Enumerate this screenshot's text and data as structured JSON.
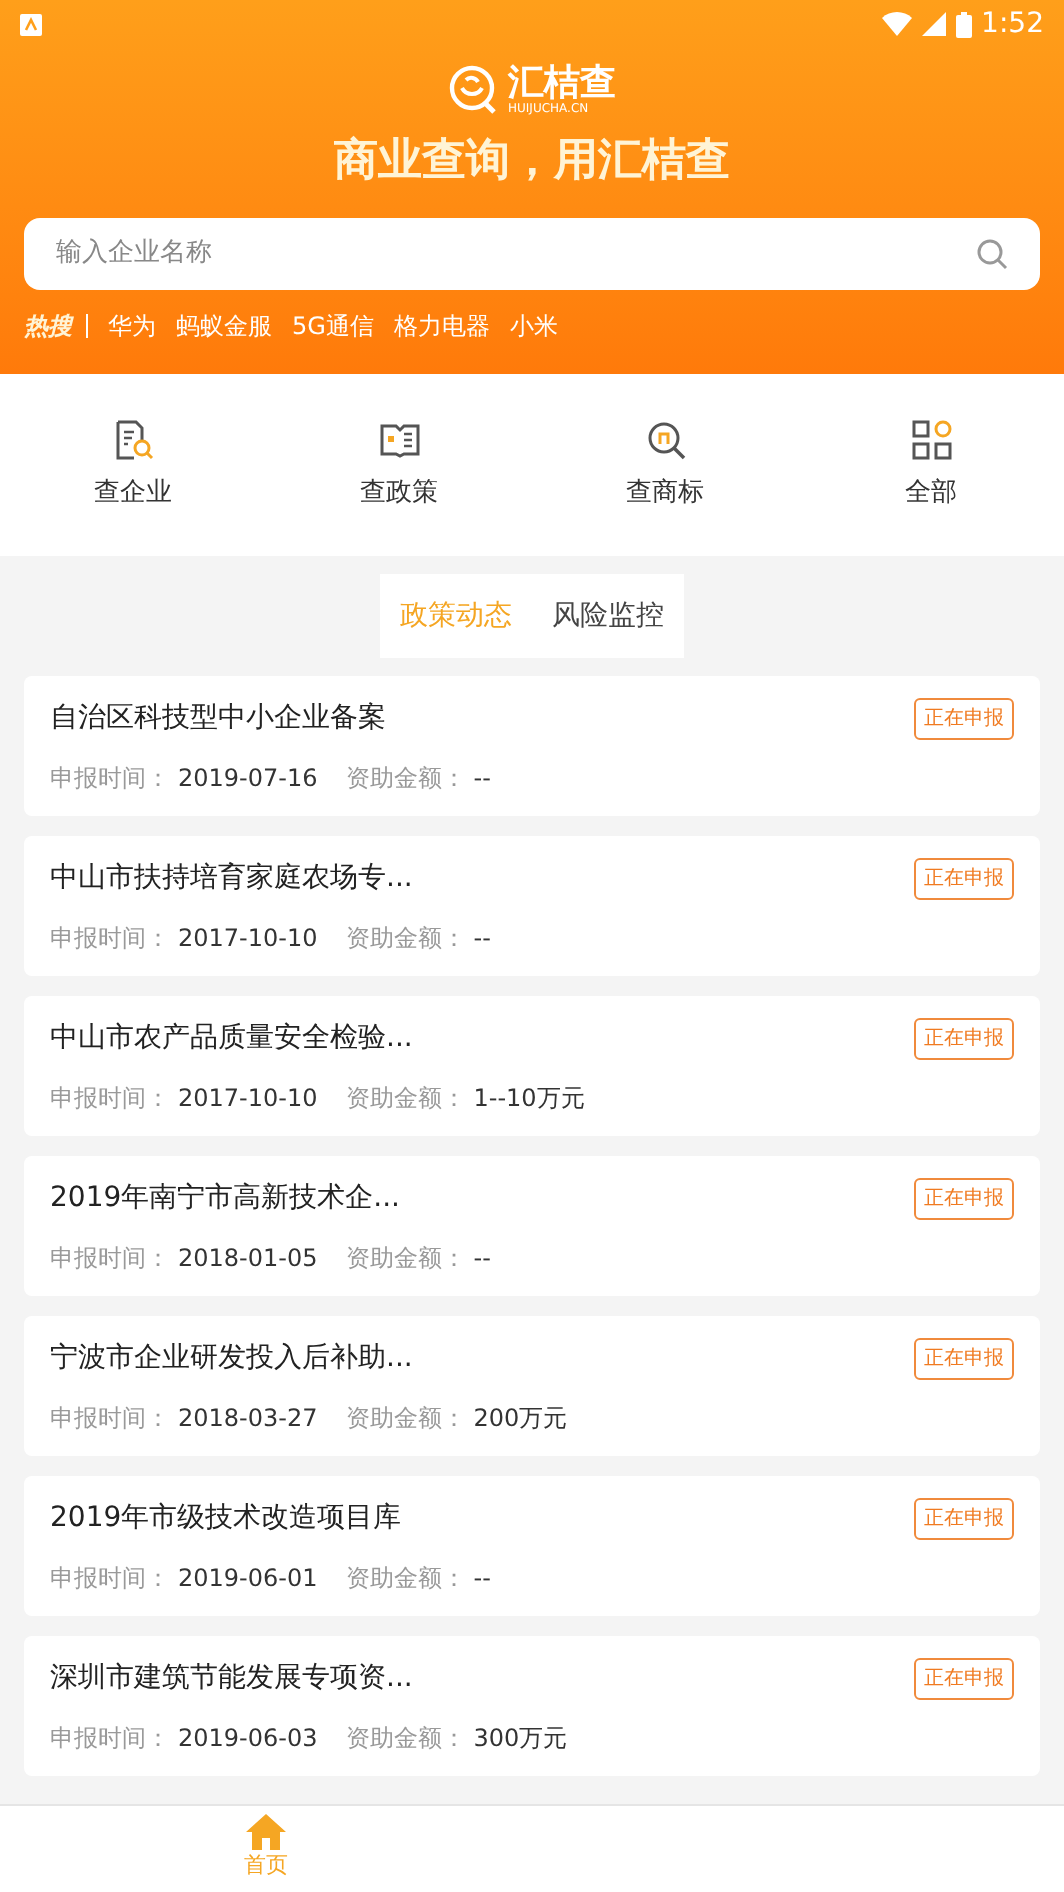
{
  "status_bar": {
    "time": "1:52"
  },
  "header": {
    "logo": {
      "name": "汇桔查",
      "domain": "HUIJUCHA.CN"
    },
    "slogan": "商业查询，用汇桔查"
  },
  "search": {
    "placeholder": "输入企业名称"
  },
  "hot_search": {
    "label": "热搜",
    "terms": [
      "华为",
      "蚂蚁金服",
      "5G通信",
      "格力电器",
      "小米"
    ]
  },
  "shortcuts": [
    {
      "label": "查企业",
      "kind": "company"
    },
    {
      "label": "查政策",
      "kind": "policy"
    },
    {
      "label": "查商标",
      "kind": "trademark"
    },
    {
      "label": "全部",
      "kind": "all"
    }
  ],
  "tabs": [
    {
      "label": "政策动态",
      "selected": true
    },
    {
      "label": "风险监控",
      "selected": false
    }
  ],
  "policies": [
    {
      "title": "自治区科技型中小企业备案",
      "status": "正在申报",
      "date_label": "申报时间：",
      "date": "2019-07-16",
      "amount_label": "资助金额：",
      "amount": "--"
    },
    {
      "title": "中山市扶持培育家庭农场专...",
      "status": "正在申报",
      "date_label": "申报时间：",
      "date": "2017-10-10",
      "amount_label": "资助金额：",
      "amount": "--"
    },
    {
      "title": "中山市农产品质量安全检验...",
      "status": "正在申报",
      "date_label": "申报时间：",
      "date": "2017-10-10",
      "amount_label": "资助金额：",
      "amount": "1--10万元"
    },
    {
      "title": "2019年南宁市高新技术企...",
      "status": "正在申报",
      "date_label": "申报时间：",
      "date": "2018-01-05",
      "amount_label": "资助金额：",
      "amount": "--"
    },
    {
      "title": "宁波市企业研发投入后补助...",
      "status": "正在申报",
      "date_label": "申报时间：",
      "date": "2018-03-27",
      "amount_label": "资助金额：",
      "amount": "200万元"
    },
    {
      "title": "2019年市级技术改造项目库",
      "status": "正在申报",
      "date_label": "申报时间：",
      "date": "2019-06-01",
      "amount_label": "资助金额：",
      "amount": "--"
    },
    {
      "title": "深圳市建筑节能发展专项资...",
      "status": "正在申报",
      "date_label": "申报时间：",
      "date": "2019-06-03",
      "amount_label": "资助金额：",
      "amount": "300万元"
    }
  ],
  "bottom_nav": [
    {
      "label": "首页",
      "selected": true
    }
  ]
}
